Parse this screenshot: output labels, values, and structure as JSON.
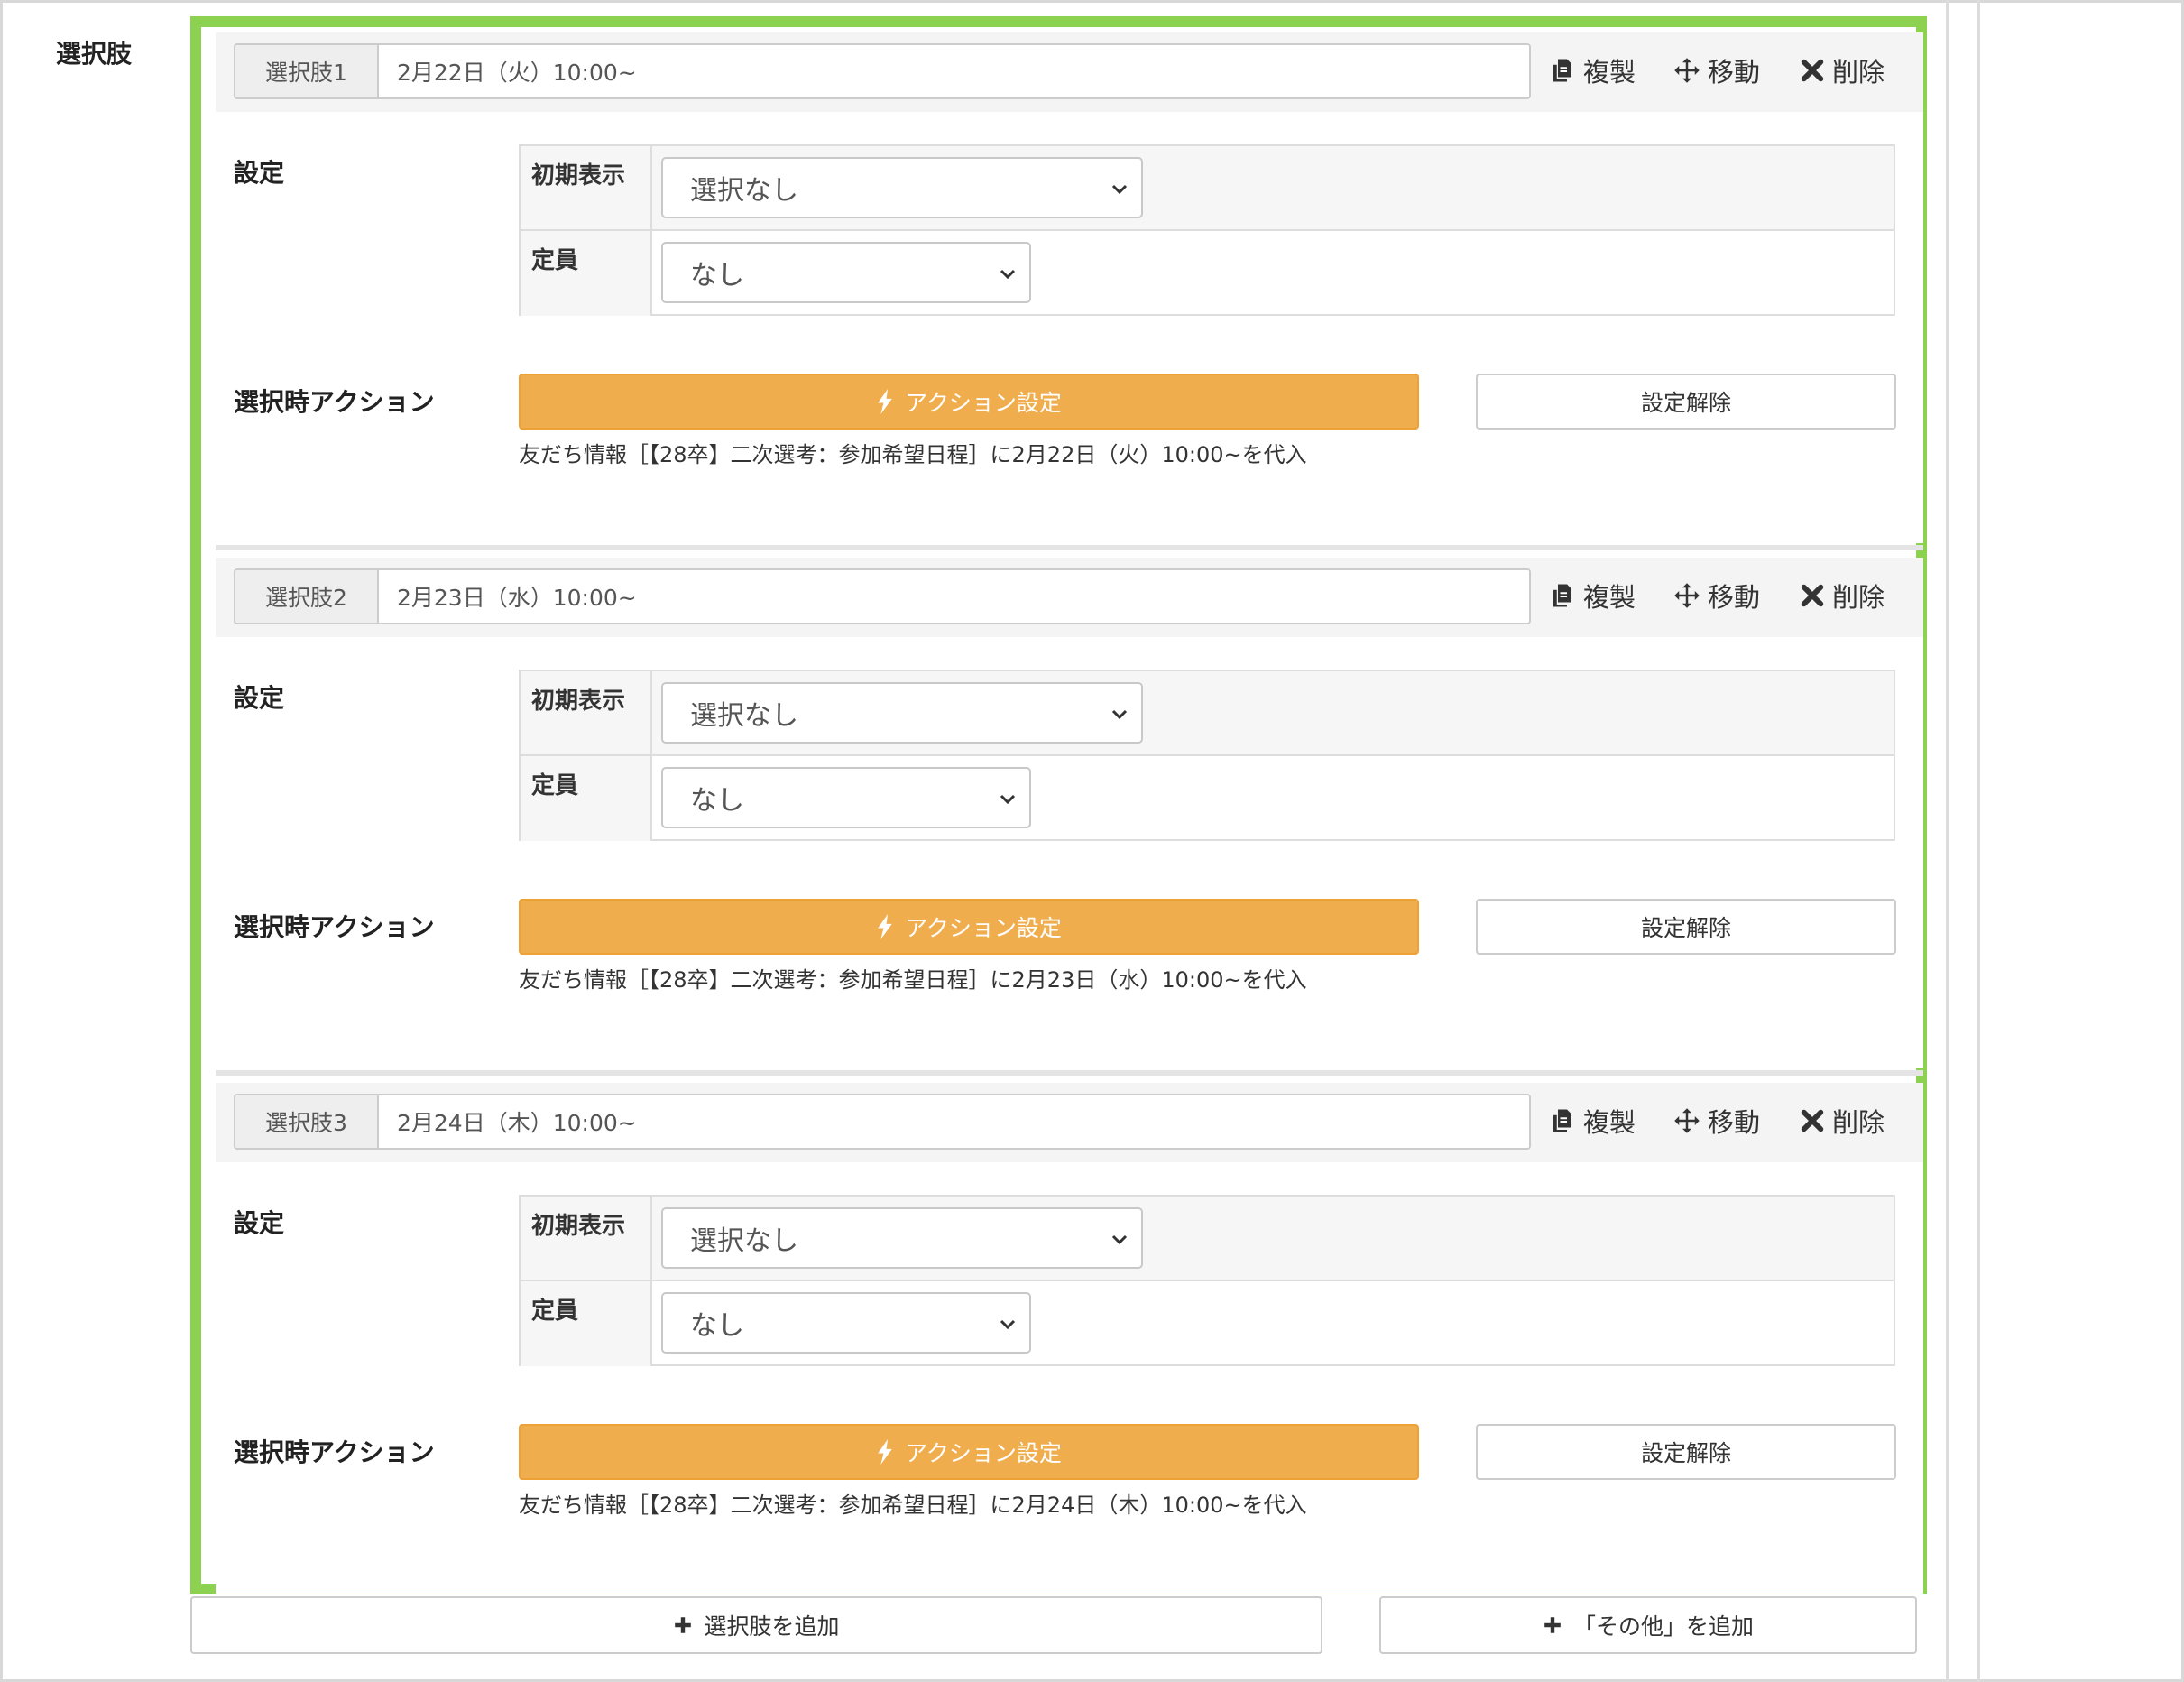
{
  "field": {
    "label": "選択肢"
  },
  "toolbar": {
    "copy_label": "複製",
    "move_label": "移動",
    "delete_label": "削除"
  },
  "section_labels": {
    "settings": "設定",
    "action": "選択時アクション"
  },
  "settings_headers": {
    "initial_display": "初期表示",
    "capacity": "定員"
  },
  "buttons": {
    "action_settings": "アクション設定",
    "clear_settings": "設定解除"
  },
  "options": [
    {
      "addon": "選択肢1",
      "label_value": "2月22日（火）10:00~",
      "initial_display": "選択なし",
      "capacity": "なし",
      "action_desc": "友だち情報［【28卒】二次選考：参加希望日程］に2月22日（火）10:00~を代入"
    },
    {
      "addon": "選択肢2",
      "label_value": "2月23日（水）10:00~",
      "initial_display": "選択なし",
      "capacity": "なし",
      "action_desc": "友だち情報［【28卒】二次選考：参加希望日程］に2月23日（水）10:00~を代入"
    },
    {
      "addon": "選択肢3",
      "label_value": "2月24日（木）10:00~",
      "initial_display": "選択なし",
      "capacity": "なし",
      "action_desc": "友だち情報［【28卒】二次選考：参加希望日程］に2月24日（木）10:00~を代入"
    }
  ],
  "add_buttons": {
    "add_option": "選択肢を追加",
    "add_other": "「その他」を追加"
  },
  "colors": {
    "highlight": "#8cd14f",
    "action": "#f0ad4e"
  },
  "icons": {
    "copy": "copy-icon",
    "move": "move-icon",
    "delete": "close-icon",
    "bolt": "bolt-icon",
    "add": "plus-icon",
    "chevron": "chevron-down-icon"
  }
}
